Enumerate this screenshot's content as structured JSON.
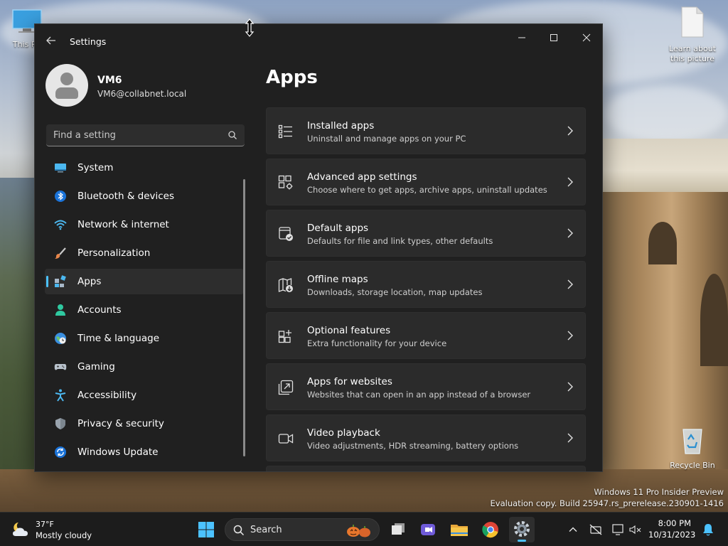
{
  "desktop": {
    "icons": [
      {
        "label": "This PC"
      },
      {
        "label": "Learn about this picture"
      },
      {
        "label": "Recycle Bin"
      }
    ],
    "watermark": {
      "line1": "Windows 11 Pro Insider Preview",
      "line2": "Evaluation copy. Build 25947.rs_prerelease.230901-1416"
    }
  },
  "window": {
    "title": "Settings",
    "controls": {
      "minimize": "—",
      "maximize": "☐",
      "close": "✕"
    }
  },
  "profile": {
    "name": "VM6",
    "email": "VM6@collabnet.local"
  },
  "search": {
    "placeholder": "Find a setting"
  },
  "nav": {
    "items": [
      {
        "label": "System",
        "icon": "system-icon"
      },
      {
        "label": "Bluetooth & devices",
        "icon": "bluetooth-icon"
      },
      {
        "label": "Network & internet",
        "icon": "wifi-icon"
      },
      {
        "label": "Personalization",
        "icon": "brush-icon"
      },
      {
        "label": "Apps",
        "icon": "apps-icon",
        "active": true
      },
      {
        "label": "Accounts",
        "icon": "person-icon"
      },
      {
        "label": "Time & language",
        "icon": "globe-clock-icon"
      },
      {
        "label": "Gaming",
        "icon": "gamepad-icon"
      },
      {
        "label": "Accessibility",
        "icon": "accessibility-icon"
      },
      {
        "label": "Privacy & security",
        "icon": "shield-icon"
      },
      {
        "label": "Windows Update",
        "icon": "update-icon"
      }
    ]
  },
  "main": {
    "title": "Apps",
    "cards": [
      {
        "title": "Installed apps",
        "subtitle": "Uninstall and manage apps on your PC",
        "icon": "list-icon"
      },
      {
        "title": "Advanced app settings",
        "subtitle": "Choose where to get apps, archive apps, uninstall updates",
        "icon": "app-settings-icon"
      },
      {
        "title": "Default apps",
        "subtitle": "Defaults for file and link types, other defaults",
        "icon": "default-apps-icon"
      },
      {
        "title": "Offline maps",
        "subtitle": "Downloads, storage location, map updates",
        "icon": "map-icon"
      },
      {
        "title": "Optional features",
        "subtitle": "Extra functionality for your device",
        "icon": "optional-features-icon"
      },
      {
        "title": "Apps for websites",
        "subtitle": "Websites that can open in an app instead of a browser",
        "icon": "web-app-icon"
      },
      {
        "title": "Video playback",
        "subtitle": "Video adjustments, HDR streaming, battery options",
        "icon": "video-icon"
      }
    ]
  },
  "taskbar": {
    "weather": {
      "temp": "37°F",
      "desc": "Mostly cloudy"
    },
    "search_label": "Search",
    "apps": [
      "start-icon",
      "task-view-icon",
      "meet-icon",
      "file-explorer-icon",
      "chrome-icon",
      "settings-icon"
    ],
    "clock": {
      "time": "8:00 PM",
      "date": "10/31/2023"
    }
  },
  "colors": {
    "accent": "#4cc2ff",
    "window_bg": "#202020",
    "card_bg": "#2b2b2b",
    "taskbar_bg": "#1c1c1c"
  }
}
